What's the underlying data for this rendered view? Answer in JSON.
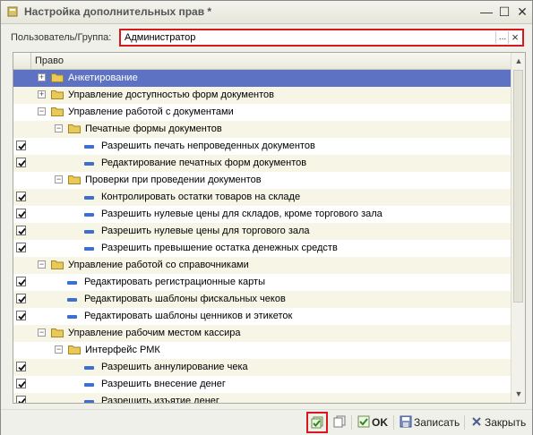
{
  "window": {
    "title": "Настройка дополнительных прав *",
    "min_icon": "minimize-icon",
    "max_icon": "maximize-icon",
    "close_icon": "close-icon"
  },
  "user_field": {
    "label": "Пользователь/Группа:",
    "value": "Администратор",
    "select_btn": "...",
    "clear_btn": "×"
  },
  "tree": {
    "column_header": "Право",
    "rows": [
      {
        "level": 0,
        "type": "group",
        "expanded": false,
        "checked": null,
        "selected": true,
        "label": "Анкетирование"
      },
      {
        "level": 0,
        "type": "group",
        "expanded": false,
        "checked": null,
        "selected": false,
        "label": "Управление доступностью форм документов"
      },
      {
        "level": 0,
        "type": "group",
        "expanded": true,
        "checked": null,
        "selected": false,
        "label": "Управление работой с документами"
      },
      {
        "level": 1,
        "type": "group",
        "expanded": true,
        "checked": null,
        "selected": false,
        "label": "Печатные формы документов"
      },
      {
        "level": 2,
        "type": "item",
        "checked": true,
        "selected": false,
        "label": "Разрешить печать непроведенных документов"
      },
      {
        "level": 2,
        "type": "item",
        "checked": true,
        "selected": false,
        "label": "Редактирование печатных форм документов"
      },
      {
        "level": 1,
        "type": "group",
        "expanded": true,
        "checked": null,
        "selected": false,
        "label": "Проверки при проведении документов"
      },
      {
        "level": 2,
        "type": "item",
        "checked": true,
        "selected": false,
        "label": "Контролировать остатки товаров на складе"
      },
      {
        "level": 2,
        "type": "item",
        "checked": true,
        "selected": false,
        "label": "Разрешить нулевые цены для складов, кроме торгового зала"
      },
      {
        "level": 2,
        "type": "item",
        "checked": true,
        "selected": false,
        "label": "Разрешить нулевые цены для торгового зала"
      },
      {
        "level": 2,
        "type": "item",
        "checked": true,
        "selected": false,
        "label": "Разрешить превышение остатка денежных средств"
      },
      {
        "level": 0,
        "type": "group",
        "expanded": true,
        "checked": null,
        "selected": false,
        "label": "Управление работой со справочниками"
      },
      {
        "level": 1,
        "type": "item",
        "checked": true,
        "selected": false,
        "label": "Редактировать регистрационные карты"
      },
      {
        "level": 1,
        "type": "item",
        "checked": true,
        "selected": false,
        "label": "Редактировать шаблоны фискальных чеков"
      },
      {
        "level": 1,
        "type": "item",
        "checked": true,
        "selected": false,
        "label": "Редактировать шаблоны ценников и этикеток"
      },
      {
        "level": 0,
        "type": "group",
        "expanded": true,
        "checked": null,
        "selected": false,
        "label": "Управление рабочим местом кассира"
      },
      {
        "level": 1,
        "type": "group",
        "expanded": true,
        "checked": null,
        "selected": false,
        "label": "Интерфейс РМК"
      },
      {
        "level": 2,
        "type": "item",
        "checked": true,
        "selected": false,
        "label": "Разрешить аннулирование чека"
      },
      {
        "level": 2,
        "type": "item",
        "checked": true,
        "selected": false,
        "label": "Разрешить внесение денег"
      },
      {
        "level": 2,
        "type": "item",
        "checked": true,
        "selected": false,
        "label": "Разрешить изъятие денег"
      }
    ]
  },
  "footer": {
    "check_all_icon": "check-all-icon",
    "copy_icon": "copy-icon",
    "ok_label": "OK",
    "save_label": "Записать",
    "close_label": "Закрыть"
  },
  "colors": {
    "selection": "#5d72c2",
    "alt_row": "#f6f5e6",
    "highlight_border": "#d7191e",
    "folder": "#e8c95a",
    "leaf": "#3c6fd0"
  }
}
